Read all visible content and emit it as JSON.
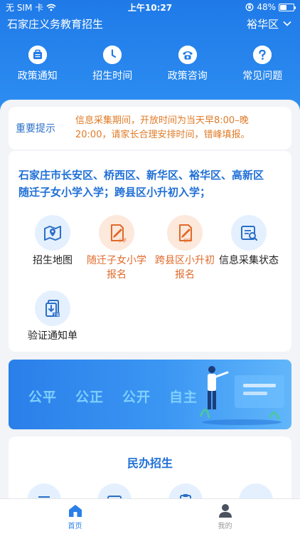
{
  "status_bar": {
    "carrier": "无 SIM 卡",
    "time": "上午10:27",
    "battery_percent": "48%",
    "battery_level": 0.48
  },
  "header": {
    "title": "石家庄义务教育招生",
    "district": "裕华区",
    "district_icon": "chevron-down-icon"
  },
  "quick_nav": [
    {
      "label": "政策通知",
      "icon": "notice-bag-icon"
    },
    {
      "label": "招生时间",
      "icon": "clock-icon"
    },
    {
      "label": "政策咨询",
      "icon": "phone-icon"
    },
    {
      "label": "常见问题",
      "icon": "question-icon"
    }
  ],
  "notice": {
    "tag": "重要提示",
    "line1": "信息采集期间，开放时间为当天早8:00–晚",
    "line2": "20:00，请家长合理安排时间，错峰填报。"
  },
  "services": {
    "title_line1": "石家庄市长安区、桥西区、新华区、裕华区、高新区",
    "title_line2": "随迁子女小学入学；跨县区小升初入学；",
    "items": [
      {
        "label_line1": "招生地图",
        "label_line2": "",
        "icon": "map-icon",
        "icon_text": ""
      },
      {
        "label_line1": "随迁子女小学",
        "label_line2": "报名",
        "icon": "primary-signup-icon",
        "icon_text": "小学"
      },
      {
        "label_line1": "跨县区小升初",
        "label_line2": "报名",
        "icon": "junior-signup-icon",
        "icon_text": "初中"
      },
      {
        "label_line1": "信息采集状态",
        "label_line2": "",
        "icon": "info-status-icon",
        "icon_text": ""
      },
      {
        "label_line1": "验证通知单",
        "label_line2": "",
        "icon": "download-notice-icon",
        "icon_text": "下载"
      }
    ]
  },
  "banner": {
    "slogan": [
      "公平",
      "公正",
      "公开",
      "自主"
    ]
  },
  "private_section": {
    "title": "民办招生"
  },
  "tab_bar": [
    {
      "label": "首页",
      "icon": "home-icon",
      "active": true
    },
    {
      "label": "我的",
      "icon": "profile-icon",
      "active": false
    }
  ],
  "colors": {
    "primary": "#1f7ae8",
    "accent_orange": "#e06a2a",
    "notice_text": "#e07b27",
    "title_blue": "#1f6fd6"
  }
}
